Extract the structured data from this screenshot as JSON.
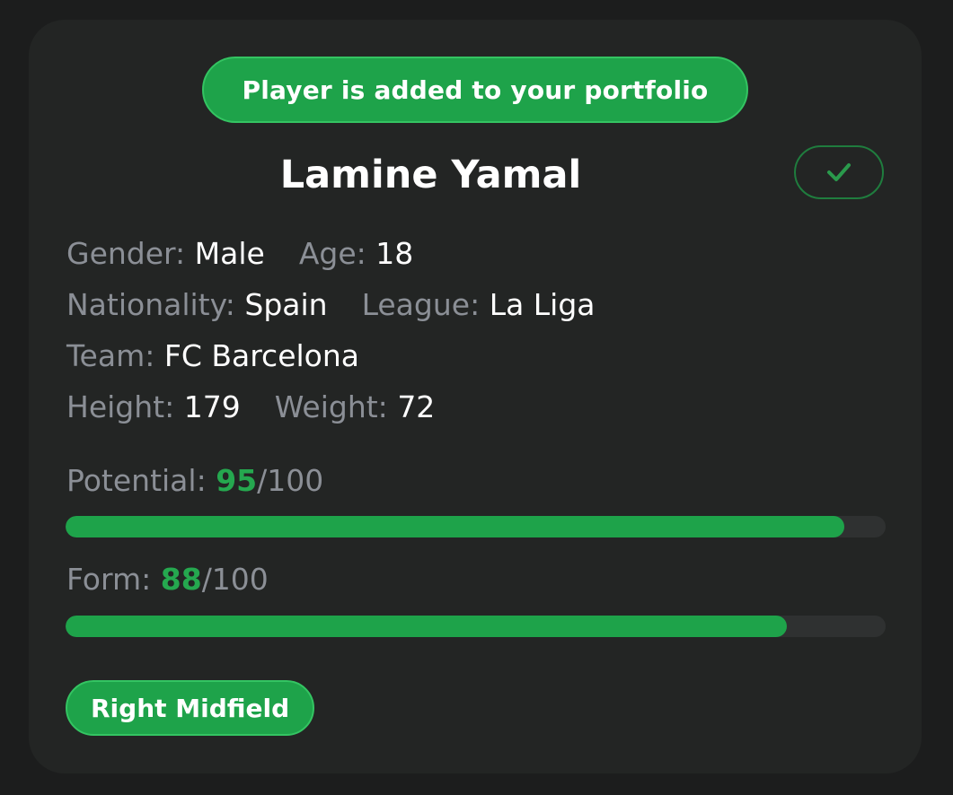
{
  "toast": {
    "text": "Player is added to your portfolio"
  },
  "player": {
    "name": "Lamine Yamal",
    "gender_label": "Gender:",
    "gender": "Male",
    "age_label": "Age:",
    "age": "18",
    "nationality_label": "Nationality:",
    "nationality": "Spain",
    "league_label": "League:",
    "league": "La Liga",
    "team_label": "Team:",
    "team": "FC Barcelona",
    "height_label": "Height:",
    "height": "179",
    "weight_label": "Weight:",
    "weight": "72"
  },
  "metrics": {
    "potential": {
      "label": "Potential:",
      "value": "95",
      "max": "/100",
      "fraction": 0.95
    },
    "form": {
      "label": "Form:",
      "value": "88",
      "max": "/100",
      "fraction": 0.88
    }
  },
  "position": {
    "text": "Right Midfield"
  },
  "icons": {
    "confirm": "checkmark-icon"
  },
  "colors": {
    "accent": "#1ea34a",
    "accent_text": "#25a84f",
    "label": "#8b8f96",
    "card": "#232524",
    "background": "#1c1d1d"
  }
}
